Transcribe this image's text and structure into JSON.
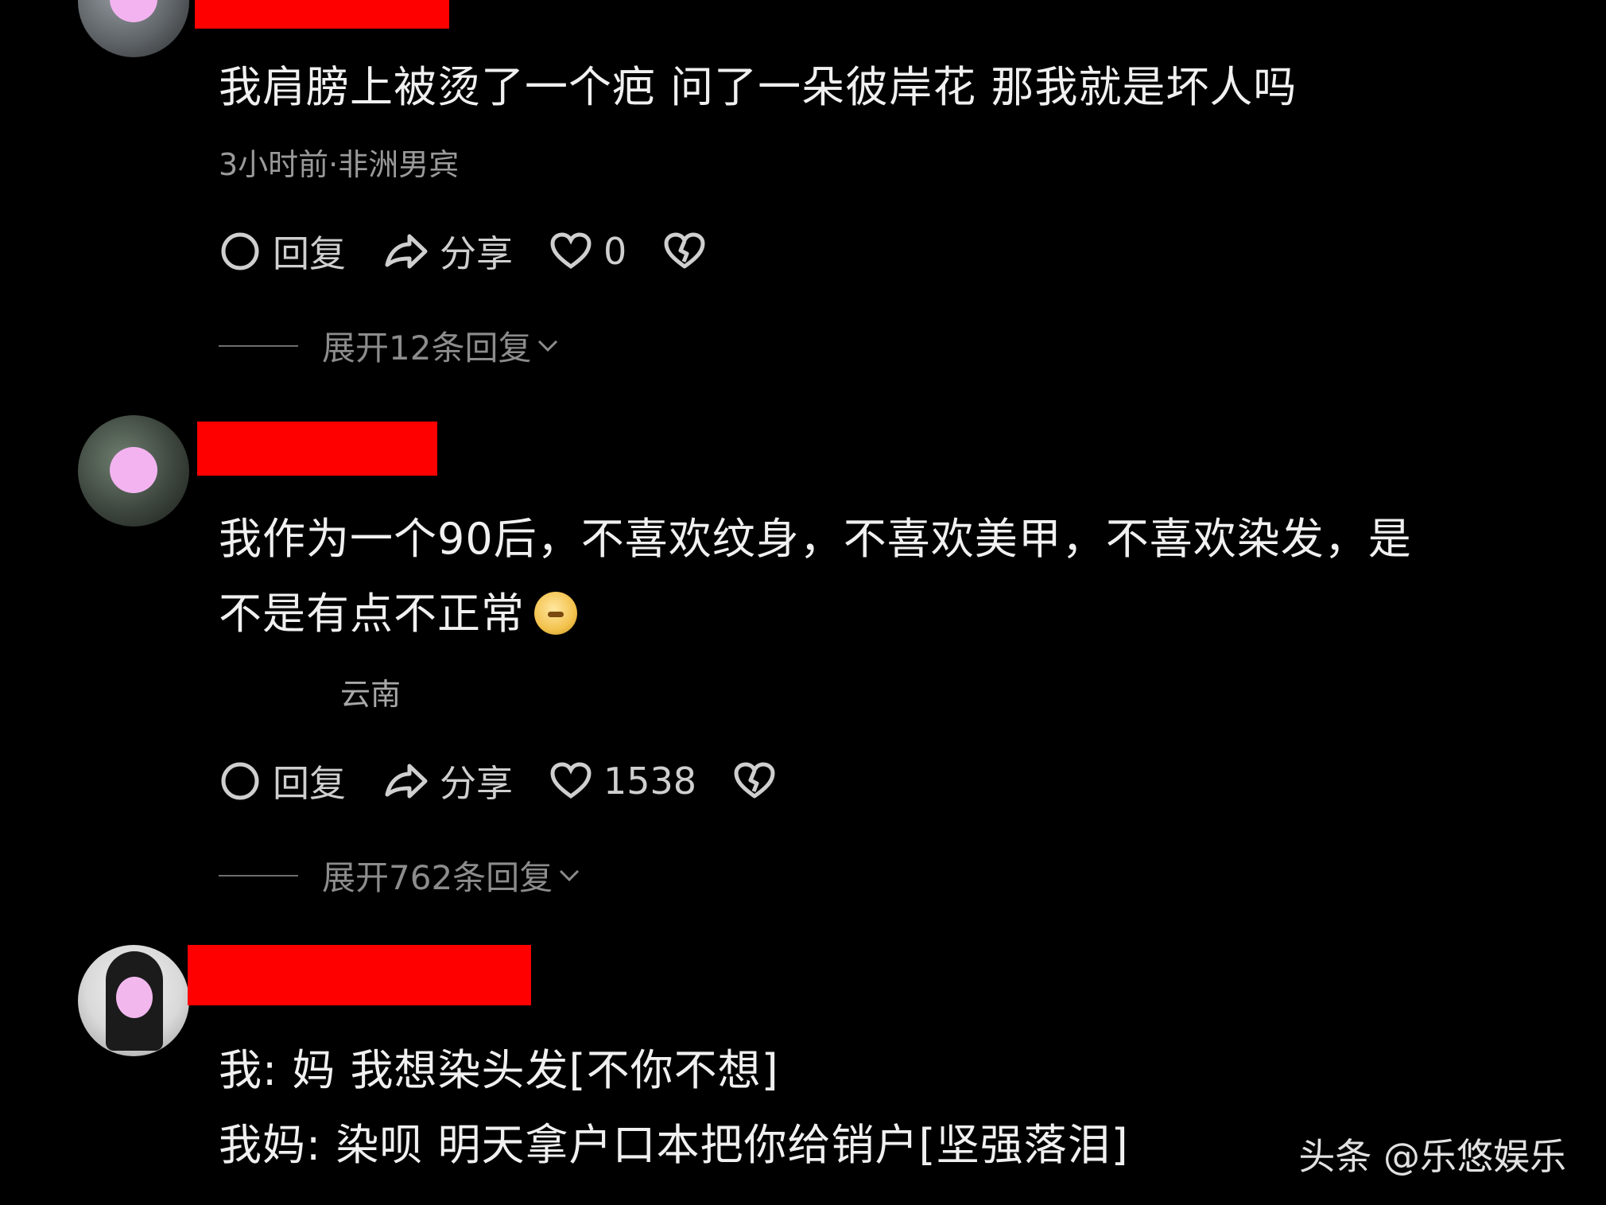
{
  "comments": [
    {
      "lines": [
        "我肩膀上被烫了一个疤 问了一朵彼岸花 那我就是坏人吗"
      ],
      "meta": "3小时前·非洲男宾",
      "actions": {
        "reply": "回复",
        "share": "分享",
        "likes": "0"
      },
      "expand": "展开12条回复"
    },
    {
      "lines": [
        "我作为一个90后，不喜欢纹身，不喜欢美甲，不喜欢染发，是",
        "不是有点不正常"
      ],
      "meta": "云南",
      "actions": {
        "reply": "回复",
        "share": "分享",
        "likes": "1538"
      },
      "expand": "展开762条回复"
    },
    {
      "lines": [
        "我: 妈 我想染头发[不你不想]",
        "我妈: 染呗 明天拿户口本把你给销户[坚强落泪]"
      ],
      "meta": "",
      "actions": {},
      "expand": ""
    }
  ],
  "watermark": "头条 @乐悠娱乐",
  "colors": {
    "background": "#000000",
    "redact": "#ff0000",
    "text": "#f0f0f0",
    "muted": "#9a9a9a"
  },
  "icons": [
    "comment-icon",
    "share-icon",
    "heart-icon",
    "dislike-icon",
    "chevron-down-icon"
  ]
}
